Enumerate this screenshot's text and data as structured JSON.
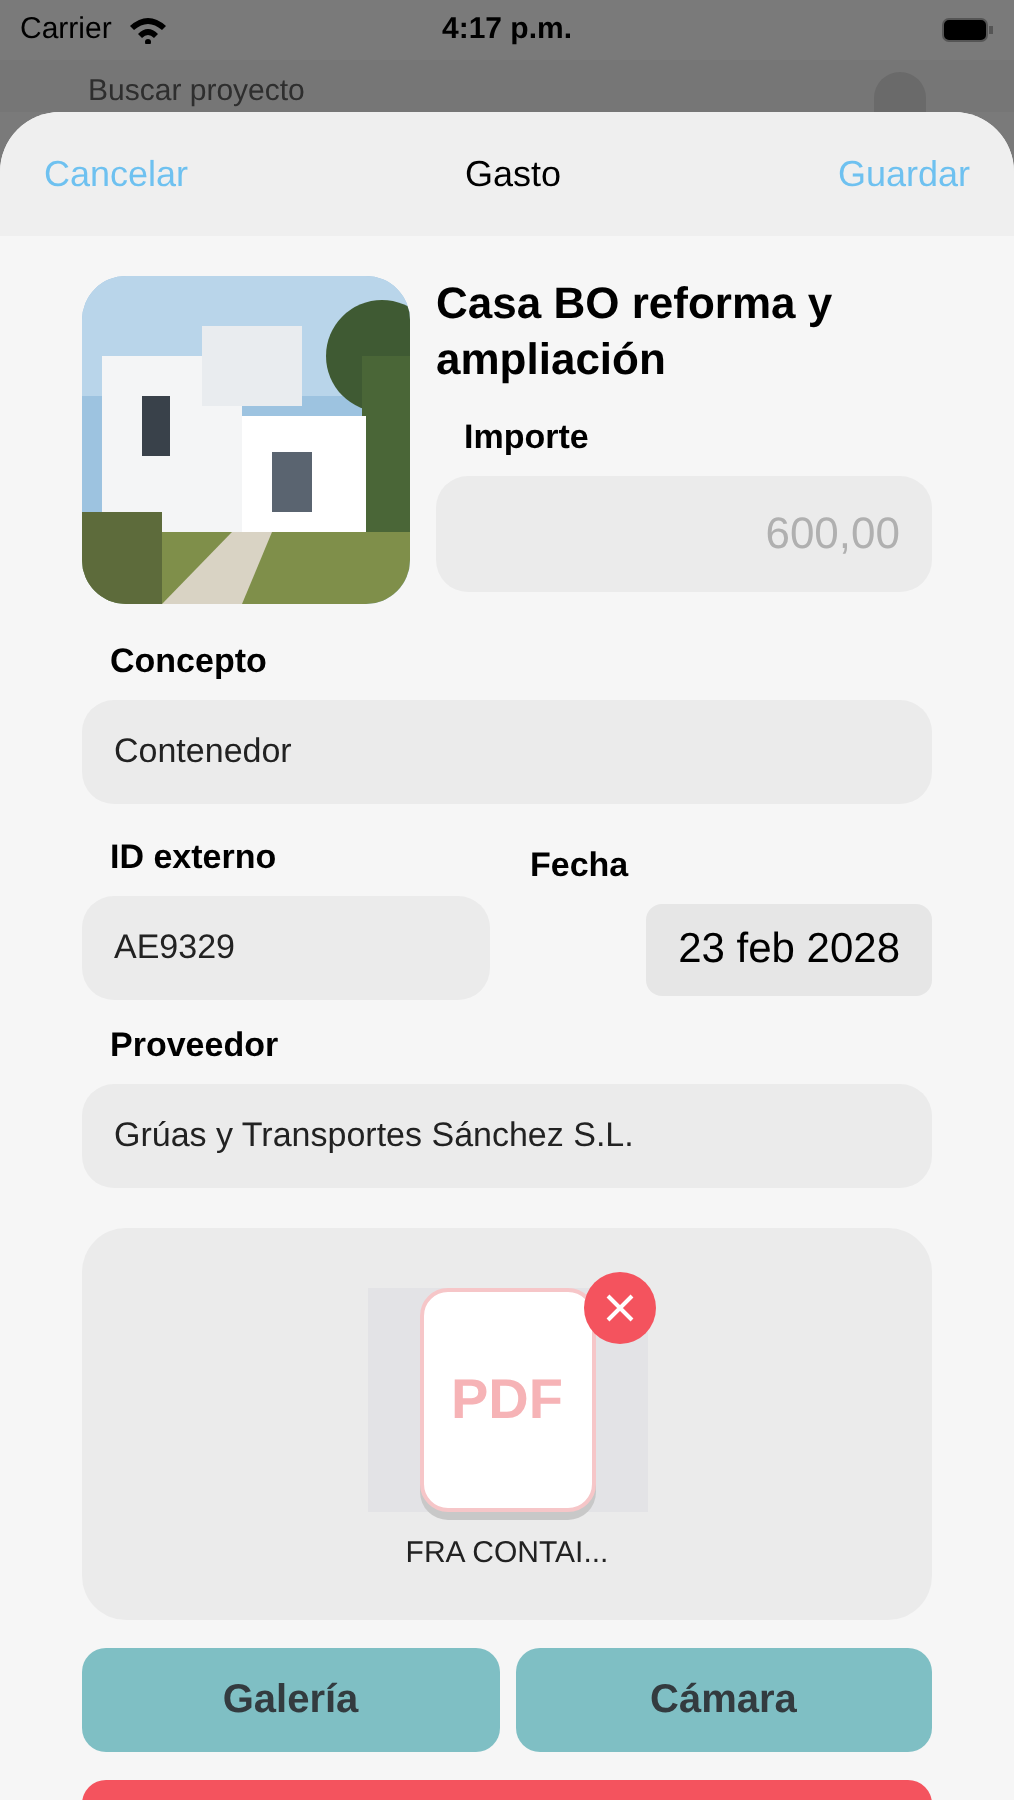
{
  "status_bar": {
    "carrier": "Carrier",
    "time": "4:17 p.m."
  },
  "background": {
    "search_placeholder": "Buscar proyecto"
  },
  "nav": {
    "cancel": "Cancelar",
    "title": "Gasto",
    "save": "Guardar"
  },
  "project": {
    "name": "Casa BO reforma y ampliación"
  },
  "fields": {
    "amount": {
      "label": "Importe",
      "placeholder": "600,00"
    },
    "concept": {
      "label": "Concepto",
      "value": "Contenedor"
    },
    "external_id": {
      "label": "ID externo",
      "value": "AE9329"
    },
    "date": {
      "label": "Fecha",
      "value": "23 feb 2028"
    },
    "supplier": {
      "label": "Proveedor",
      "value": "Grúas y Transportes Sánchez S.L."
    }
  },
  "attachments": [
    {
      "file_type": "PDF",
      "name": "FRA CONTAI..."
    }
  ],
  "buttons": [
    "Galería",
    "Cámara"
  ]
}
